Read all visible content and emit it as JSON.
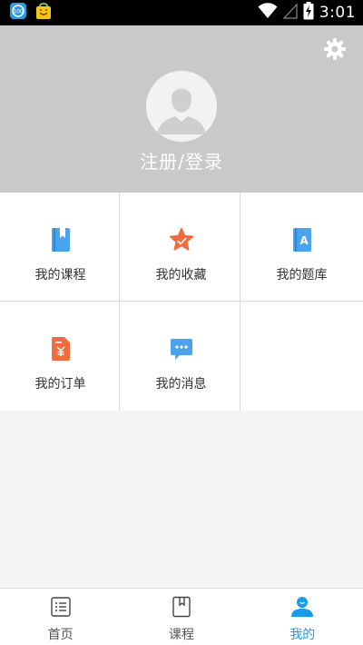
{
  "status_bar": {
    "time": "3:01",
    "notification_icons": [
      "app-notification-icon",
      "bag-notification-icon"
    ],
    "indicators": [
      "wifi-icon",
      "signal-icon",
      "battery-charging-icon"
    ]
  },
  "profile": {
    "login_label": "注册/登录",
    "avatar_icon": "default-avatar-icon",
    "settings_icon": "gear-icon"
  },
  "menu": {
    "items": [
      {
        "label": "我的课程",
        "icon": "course-book-icon",
        "color": "#4aa3ec"
      },
      {
        "label": "我的收藏",
        "icon": "favorite-star-icon",
        "color": "#f26b3d"
      },
      {
        "label": "我的题库",
        "icon": "question-bank-icon",
        "color": "#4aa3ec"
      },
      {
        "label": "我的订单",
        "icon": "order-icon",
        "color": "#f26b3d"
      },
      {
        "label": "我的消息",
        "icon": "message-icon",
        "color": "#4aa3ec"
      }
    ]
  },
  "tabbar": {
    "tabs": [
      {
        "label": "首页",
        "icon": "home-list-icon",
        "active": false
      },
      {
        "label": "课程",
        "icon": "course-icon",
        "active": false
      },
      {
        "label": "我的",
        "icon": "profile-icon",
        "active": true
      }
    ]
  },
  "colors": {
    "accent": "#1a9be8",
    "header_bg": "#c9c9c9",
    "page_bg": "#f4f4f4"
  }
}
